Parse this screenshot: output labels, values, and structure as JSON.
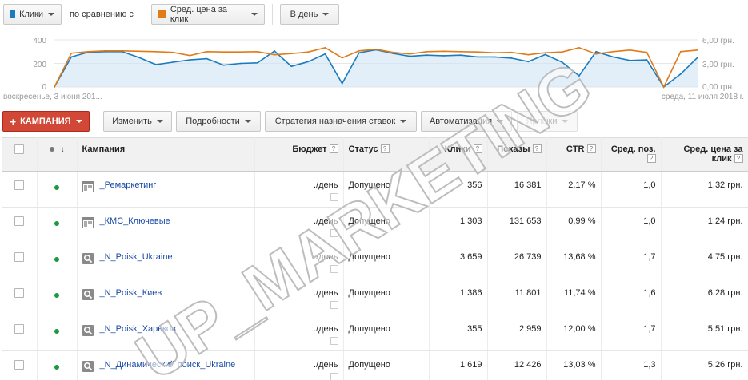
{
  "topbar": {
    "metric1": {
      "label": "Клики",
      "color": "#1a7bbf"
    },
    "compare_text": "по сравнению с",
    "metric2": {
      "label": "Сред. цена за клик",
      "color": "#e07b18"
    },
    "period": "В день"
  },
  "chart": {
    "y_left_ticks": [
      "400",
      "200",
      "0"
    ],
    "y_right_ticks": [
      "6,00 грн.",
      "3,00 грн.",
      "0,00 грн."
    ],
    "start_label": "воскресенье, 3 июня 201...",
    "end_label": "среда, 11 июля 2018 г."
  },
  "chart_data": {
    "type": "line",
    "series": [
      {
        "name": "Клики",
        "axis": "left",
        "color": "#1a7bbf",
        "values": [
          0,
          255,
          295,
          300,
          300,
          250,
          190,
          210,
          230,
          240,
          185,
          200,
          205,
          305,
          175,
          215,
          280,
          30,
          290,
          315,
          285,
          260,
          270,
          265,
          270,
          255,
          255,
          245,
          215,
          275,
          210,
          95,
          300,
          255,
          225,
          230,
          0,
          110,
          250
        ]
      },
      {
        "name": "Сред. цена за клик",
        "axis": "right",
        "color": "#e07b18",
        "values": [
          0,
          4.3,
          4.5,
          4.6,
          4.6,
          4.55,
          4.5,
          4.4,
          4.0,
          4.5,
          4.45,
          4.45,
          4.5,
          4.1,
          4.25,
          4.45,
          5.0,
          3.7,
          4.6,
          4.8,
          4.4,
          4.2,
          4.5,
          4.55,
          4.5,
          4.45,
          4.35,
          4.4,
          4.1,
          4.35,
          4.45,
          5.0,
          4.2,
          4.5,
          4.7,
          4.4,
          0,
          4.5,
          4.7
        ]
      }
    ],
    "ylim_left": [
      0,
      400
    ],
    "ylim_right": [
      0,
      6
    ]
  },
  "toolbar": {
    "campaign_button": "КАМПАНИЯ",
    "edit": "Изменить",
    "details": "Подробности",
    "bidding": "Стратегия назначения ставок",
    "automation": "Автоматизация",
    "labels": "Ярлыки"
  },
  "table": {
    "headers": {
      "campaign": "Кампания",
      "budget": "Бюджет",
      "status": "Статус",
      "clicks": "Клики",
      "impressions": "Показы",
      "ctr": "CTR",
      "avg_pos": "Сред. поз.",
      "avg_cpc": "Сред. цена за клик"
    },
    "qm": "?",
    "rows": [
      {
        "icon": "display",
        "name": "_Ремаркетинг",
        "budget": "./день",
        "status": "Допущено",
        "clicks": "356",
        "impressions": "16 381",
        "ctr": "2,17 %",
        "pos": "1,0",
        "cpc": "1,32 грн."
      },
      {
        "icon": "display",
        "name": "_КМС_Ключевые",
        "budget": "./день",
        "status": "Допущено",
        "clicks": "1 303",
        "impressions": "131 653",
        "ctr": "0,99 %",
        "pos": "1,0",
        "cpc": "1,24 грн."
      },
      {
        "icon": "search",
        "name": "_N_Poisk_Ukraine",
        "budget": "./день",
        "status": "Допущено",
        "clicks": "3 659",
        "impressions": "26 739",
        "ctr": "13,68 %",
        "pos": "1,7",
        "cpc": "4,75 грн."
      },
      {
        "icon": "search",
        "name": "_N_Poisk_Киев",
        "budget": "./день",
        "status": "Допущено",
        "clicks": "1 386",
        "impressions": "11 801",
        "ctr": "11,74 %",
        "pos": "1,6",
        "cpc": "6,28 грн."
      },
      {
        "icon": "search",
        "name": "_N_Poisk_Харьков",
        "budget": "./день",
        "status": "Допущено",
        "clicks": "355",
        "impressions": "2 959",
        "ctr": "12,00 %",
        "pos": "1,7",
        "cpc": "5,51 грн."
      },
      {
        "icon": "search",
        "name": "_N_Динамический поиск_Ukraine",
        "budget": "./день",
        "status": "Допущено",
        "clicks": "1 619",
        "impressions": "12 426",
        "ctr": "13,03 %",
        "pos": "1,3",
        "cpc": "5,26 грн."
      }
    ]
  },
  "watermark": "UP_MARKETING"
}
